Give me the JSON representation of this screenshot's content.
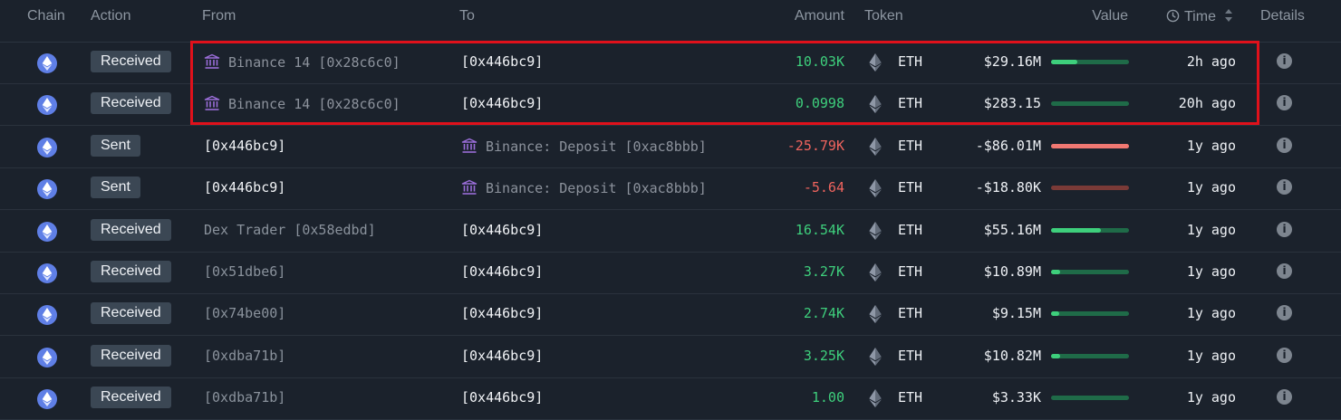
{
  "header": {
    "chain": "Chain",
    "action": "Action",
    "from": "From",
    "to": "To",
    "amount": "Amount",
    "token": "Token",
    "value": "Value",
    "time": "Time",
    "details": "Details"
  },
  "colors": {
    "background": "#1b222c",
    "positive": "#3ecf7c",
    "negative": "#f0645e",
    "bar_track": "#1f6b48",
    "bar_fill_pos": "#3ecf7c",
    "bar_fill_neg": "#f07872",
    "bar_track_neg": "#7a3a37",
    "highlight": "#e0111b",
    "chain_eth": "#5f7fe6"
  },
  "rows": [
    {
      "action": "Received",
      "from": "Binance 14 [0x28c6c0]",
      "from_entity": true,
      "from_bright": false,
      "to": "[0x446bc9]",
      "to_entity": false,
      "to_bright": true,
      "amount": "10.03K",
      "amount_sign": "pos",
      "token": "ETH",
      "value": "$29.16M",
      "bar": 0.34,
      "bar_sign": "pos",
      "time": "2h ago"
    },
    {
      "action": "Received",
      "from": "Binance 14 [0x28c6c0]",
      "from_entity": true,
      "from_bright": false,
      "to": "[0x446bc9]",
      "to_entity": false,
      "to_bright": true,
      "amount": "0.0998",
      "amount_sign": "pos",
      "token": "ETH",
      "value": "$283.15",
      "bar": 0.0,
      "bar_sign": "pos",
      "time": "20h ago"
    },
    {
      "action": "Sent",
      "from": "[0x446bc9]",
      "from_entity": false,
      "from_bright": true,
      "to": "Binance: Deposit [0xac8bbb]",
      "to_entity": true,
      "to_bright": false,
      "amount": "-25.79K",
      "amount_sign": "neg",
      "token": "ETH",
      "value": "-$86.01M",
      "bar": 1.0,
      "bar_sign": "neg",
      "time": "1y ago"
    },
    {
      "action": "Sent",
      "from": "[0x446bc9]",
      "from_entity": false,
      "from_bright": true,
      "to": "Binance: Deposit [0xac8bbb]",
      "to_entity": true,
      "to_bright": false,
      "amount": "-5.64",
      "amount_sign": "neg",
      "token": "ETH",
      "value": "-$18.80K",
      "bar": 0.0,
      "bar_sign": "neg",
      "time": "1y ago"
    },
    {
      "action": "Received",
      "from": "Dex Trader [0x58edbd]",
      "from_entity": false,
      "from_bright": false,
      "to": "[0x446bc9]",
      "to_entity": false,
      "to_bright": true,
      "amount": "16.54K",
      "amount_sign": "pos",
      "token": "ETH",
      "value": "$55.16M",
      "bar": 0.64,
      "bar_sign": "pos",
      "time": "1y ago"
    },
    {
      "action": "Received",
      "from": "[0x51dbe6]",
      "from_entity": false,
      "from_bright": false,
      "to": "[0x446bc9]",
      "to_entity": false,
      "to_bright": true,
      "amount": "3.27K",
      "amount_sign": "pos",
      "token": "ETH",
      "value": "$10.89M",
      "bar": 0.12,
      "bar_sign": "pos",
      "time": "1y ago"
    },
    {
      "action": "Received",
      "from": "[0x74be00]",
      "from_entity": false,
      "from_bright": false,
      "to": "[0x446bc9]",
      "to_entity": false,
      "to_bright": true,
      "amount": "2.74K",
      "amount_sign": "pos",
      "token": "ETH",
      "value": "$9.15M",
      "bar": 0.1,
      "bar_sign": "pos",
      "time": "1y ago"
    },
    {
      "action": "Received",
      "from": "[0xdba71b]",
      "from_entity": false,
      "from_bright": false,
      "to": "[0x446bc9]",
      "to_entity": false,
      "to_bright": true,
      "amount": "3.25K",
      "amount_sign": "pos",
      "token": "ETH",
      "value": "$10.82M",
      "bar": 0.12,
      "bar_sign": "pos",
      "time": "1y ago"
    },
    {
      "action": "Received",
      "from": "[0xdba71b]",
      "from_entity": false,
      "from_bright": false,
      "to": "[0x446bc9]",
      "to_entity": false,
      "to_bright": true,
      "amount": "1.00",
      "amount_sign": "pos",
      "token": "ETH",
      "value": "$3.33K",
      "bar": 0.0,
      "bar_sign": "pos",
      "time": "1y ago"
    }
  ]
}
